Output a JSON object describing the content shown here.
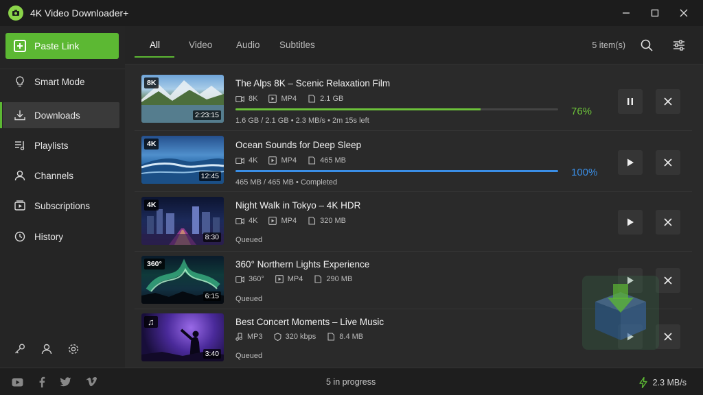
{
  "app": {
    "title": "4K Video Downloader+"
  },
  "sidebar": {
    "paste_label": "Paste Link",
    "items": [
      {
        "label": "Smart Mode",
        "icon": "bulb-icon"
      },
      {
        "label": "Downloads",
        "icon": "download-icon",
        "active": true
      },
      {
        "label": "Playlists",
        "icon": "playlist-icon"
      },
      {
        "label": "Channels",
        "icon": "user-icon"
      },
      {
        "label": "Subscriptions",
        "icon": "subscription-icon"
      },
      {
        "label": "History",
        "icon": "history-icon"
      }
    ]
  },
  "header": {
    "tabs": [
      "All",
      "Video",
      "Audio",
      "Subtitles"
    ],
    "active_tab": "All",
    "count": "5 item(s)"
  },
  "downloads": [
    {
      "title": "The Alps 8K – Scenic Relaxation Film",
      "badge": "8K",
      "duration": "2:23:15",
      "meta": [
        "8K",
        "MP4",
        "2.1 GB"
      ],
      "progress": 76,
      "percent_label": "76%",
      "status": "1.6 GB / 2.1 GB  •  2.3 MB/s  •  2m 15s left",
      "action": "pause"
    },
    {
      "title": "Ocean Sounds for Deep Sleep",
      "badge": "4K",
      "duration": "12:45",
      "meta": [
        "4K",
        "MP4",
        "465 MB"
      ],
      "progress": 100,
      "percent_label": "100%",
      "status": "465 MB / 465 MB  •  Completed",
      "action": "play"
    },
    {
      "title": "Night Walk in Tokyo – 4K HDR",
      "badge": "4K",
      "duration": "8:30",
      "meta": [
        "4K",
        "MP4",
        "320 MB"
      ],
      "status": "Queued",
      "action": "play"
    },
    {
      "title": "360° Northern Lights Experience",
      "badge": "360°",
      "duration": "6:15",
      "meta": [
        "360°",
        "MP4",
        "290 MB"
      ],
      "status": "Queued",
      "action": "play"
    },
    {
      "title": "Best Concert Moments – Live Music",
      "badge": "♫",
      "duration": "3:40",
      "meta": [
        "MP3",
        "320 kbps",
        "8.4 MB"
      ],
      "status": "Queued",
      "action": "play"
    }
  ],
  "statusbar": {
    "center": "5 in progress",
    "speed": "2.3 MB/s"
  },
  "colors": {
    "accent": "#5cb833",
    "progress_green": "#6cc13a",
    "progress_blue": "#3a8ee6",
    "pct_green": "#6cc13a",
    "pct_blue": "#3a8ee6"
  }
}
